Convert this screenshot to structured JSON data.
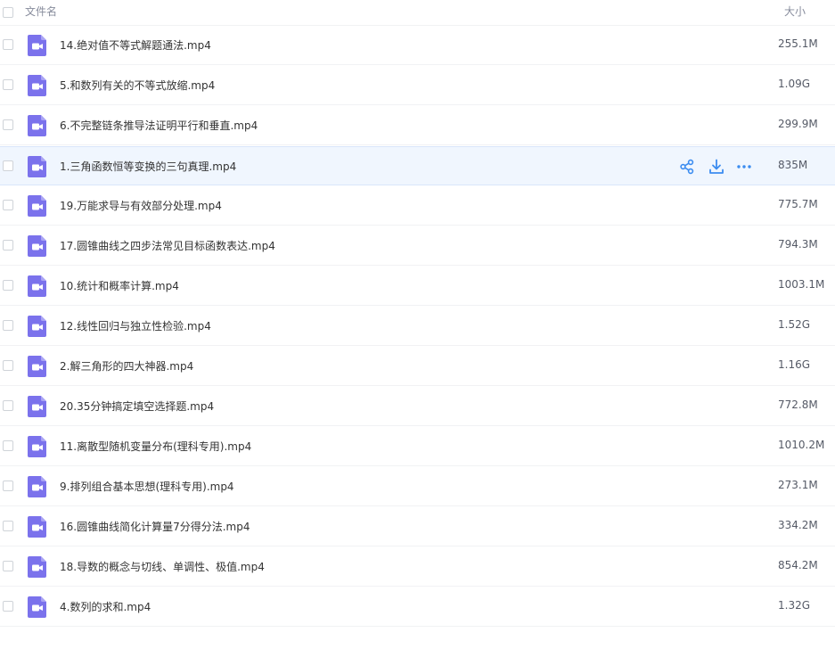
{
  "header": {
    "name_label": "文件名",
    "size_label": "大小"
  },
  "icons": {
    "file": "video-file-icon",
    "share": "share-icon",
    "download": "download-icon",
    "more": "more-icon"
  },
  "colors": {
    "video_icon": "#7b72ec",
    "action_icon": "#3b8cf0",
    "active_row_bg": "#f0f6fe"
  },
  "files": [
    {
      "name": "14.绝对值不等式解题通法.mp4",
      "size": "255.1M"
    },
    {
      "name": "5.和数列有关的不等式放缩.mp4",
      "size": "1.09G"
    },
    {
      "name": "6.不完整链条推导法证明平行和垂直.mp4",
      "size": "299.9M"
    },
    {
      "name": "1.三角函数恒等变换的三句真理.mp4",
      "size": "835M",
      "active": true
    },
    {
      "name": "19.万能求导与有效部分处理.mp4",
      "size": "775.7M"
    },
    {
      "name": "17.圆锥曲线之四步法常见目标函数表达.mp4",
      "size": "794.3M"
    },
    {
      "name": "10.统计和概率计算.mp4",
      "size": "1003.1M"
    },
    {
      "name": "12.线性回归与独立性检验.mp4",
      "size": "1.52G"
    },
    {
      "name": "2.解三角形的四大神器.mp4",
      "size": "1.16G"
    },
    {
      "name": "20.35分钟搞定填空选择题.mp4",
      "size": "772.8M"
    },
    {
      "name": "11.离散型随机变量分布(理科专用).mp4",
      "size": "1010.2M"
    },
    {
      "name": "9.排列组合基本思想(理科专用).mp4",
      "size": "273.1M"
    },
    {
      "name": "16.圆锥曲线简化计算量7分得分法.mp4",
      "size": "334.2M"
    },
    {
      "name": "18.导数的概念与切线、单调性、极值.mp4",
      "size": "854.2M"
    },
    {
      "name": "4.数列的求和.mp4",
      "size": "1.32G"
    }
  ]
}
